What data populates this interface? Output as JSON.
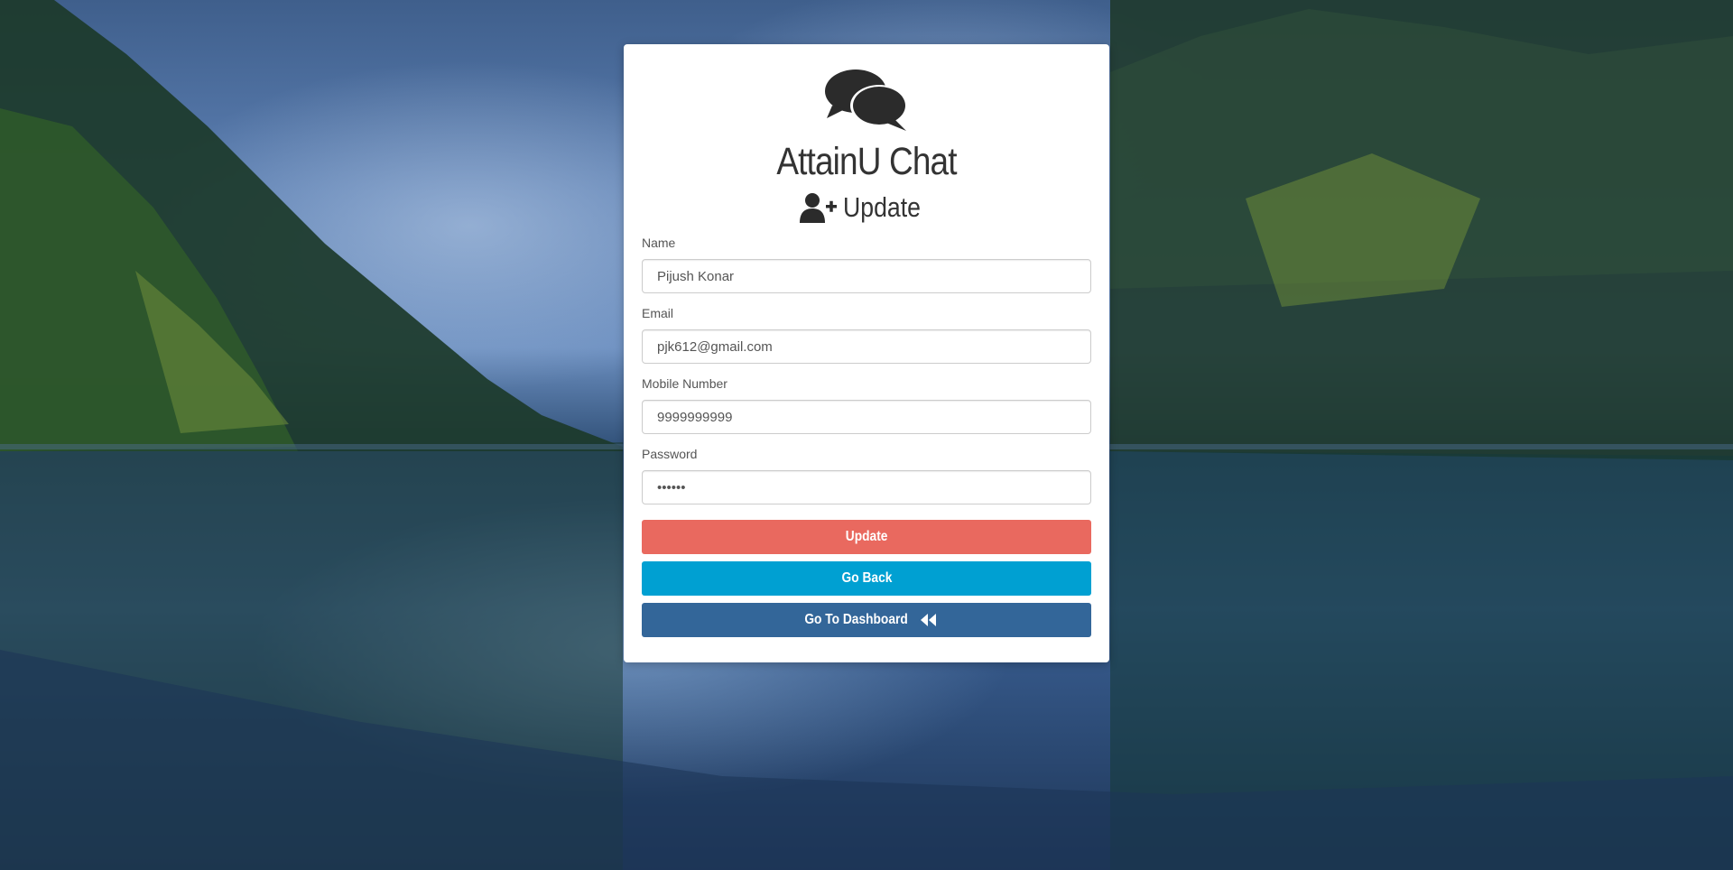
{
  "app": {
    "title": "AttainU Chat",
    "subtitle": "Update"
  },
  "form": {
    "name": {
      "label": "Name",
      "value": "Pijush Konar"
    },
    "email": {
      "label": "Email",
      "value": "pjk612@gmail.com"
    },
    "mobile": {
      "label": "Mobile Number",
      "value": "9999999999"
    },
    "password": {
      "label": "Password",
      "value": "pijush"
    }
  },
  "buttons": {
    "update": {
      "label": "Update",
      "color": "#e9695f"
    },
    "go_back": {
      "label": "Go Back",
      "color": "#00a0d2"
    },
    "dashboard": {
      "label": "Go To Dashboard",
      "color": "#336699"
    }
  },
  "icons": {
    "logo": "comments-icon",
    "subtitle": "user-plus-icon",
    "dashboard": "backward-icon"
  }
}
